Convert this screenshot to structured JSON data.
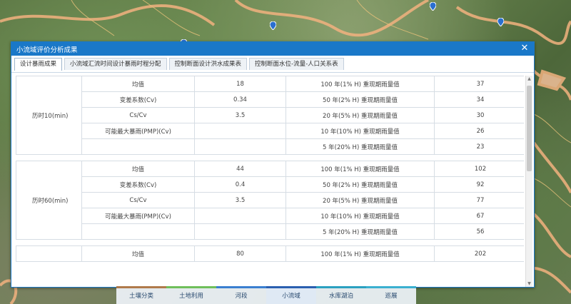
{
  "dialog": {
    "title": "小流域评价分析成果",
    "close_glyph": "✕"
  },
  "tabs": [
    {
      "label": "设计暴雨成果",
      "active": true
    },
    {
      "label": "小流域汇流时间设计暴雨时程分配",
      "active": false
    },
    {
      "label": "控制断面设计洪水成果表",
      "active": false
    },
    {
      "label": "控制断面水位-流量-人口关系表",
      "active": false
    }
  ],
  "groups": [
    {
      "label": "历时10(min)",
      "rows": [
        {
          "param": "均值",
          "value": "18",
          "period": "100 年(1% H) 重现期雨量值",
          "amount": "37"
        },
        {
          "param": "变差系数(Cv)",
          "value": "0.34",
          "period": "50 年(2% H) 重现期雨量值",
          "amount": "34"
        },
        {
          "param": "Cs/Cv",
          "value": "3.5",
          "period": "20 年(5% H) 重现期雨量值",
          "amount": "30"
        },
        {
          "param": "可能最大暴雨(PMP)(Cv)",
          "value": "",
          "period": "10 年(10% H) 重现期雨量值",
          "amount": "26"
        },
        {
          "param": "",
          "value": "",
          "period": "5 年(20% H) 重现期雨量值",
          "amount": "23"
        }
      ]
    },
    {
      "label": "历时60(min)",
      "rows": [
        {
          "param": "均值",
          "value": "44",
          "period": "100 年(1% H) 重现期雨量值",
          "amount": "102"
        },
        {
          "param": "变差系数(Cv)",
          "value": "0.4",
          "period": "50 年(2% H) 重现期雨量值",
          "amount": "92"
        },
        {
          "param": "Cs/Cv",
          "value": "3.5",
          "period": "20 年(5% H) 重现期雨量值",
          "amount": "77"
        },
        {
          "param": "可能最大暴雨(PMP)(Cv)",
          "value": "",
          "period": "10 年(10% H) 重现期雨量值",
          "amount": "67"
        },
        {
          "param": "",
          "value": "",
          "period": "5 年(20% H) 重现期雨量值",
          "amount": "56"
        }
      ]
    },
    {
      "label": "",
      "rows": [
        {
          "param": "均值",
          "value": "80",
          "period": "100 年(1% H) 重现期雨量值",
          "amount": "202"
        }
      ]
    }
  ],
  "bottom_nav": [
    {
      "label": "土壤分类",
      "color": "#b07a4a",
      "active": false
    },
    {
      "label": "土地利用",
      "color": "#6fbf5a",
      "active": false
    },
    {
      "label": "河段",
      "color": "#3a7fd0",
      "active": false
    },
    {
      "label": "小流域",
      "color": "#2a5fb0",
      "active": true
    },
    {
      "label": "水库湖泊",
      "color": "#2aa0c0",
      "active": false
    },
    {
      "label": "巡展",
      "color": "#3ab0d0",
      "active": false
    }
  ],
  "colors": {
    "accent": "#1a78c8",
    "boundary": "#f0b080"
  }
}
